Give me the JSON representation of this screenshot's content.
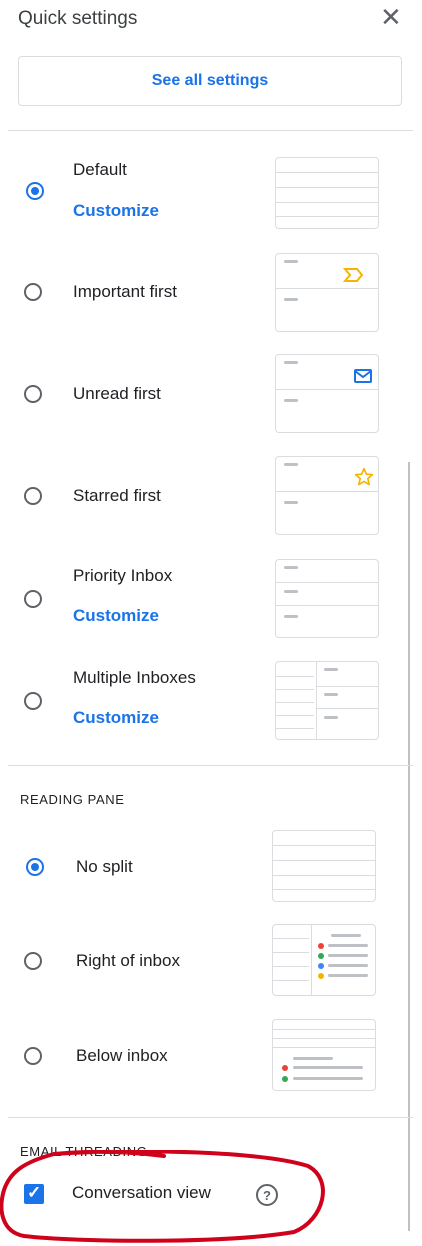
{
  "header": {
    "title": "Quick settings",
    "close_glyph": "✕"
  },
  "see_all_label": "See all settings",
  "inbox_types": [
    {
      "label": "Default",
      "customize": "Customize",
      "selected": true
    },
    {
      "label": "Important first",
      "customize": "",
      "selected": false
    },
    {
      "label": "Unread first",
      "customize": "",
      "selected": false
    },
    {
      "label": "Starred first",
      "customize": "",
      "selected": false
    },
    {
      "label": "Priority Inbox",
      "customize": "Customize",
      "selected": false
    },
    {
      "label": "Multiple Inboxes",
      "customize": "Customize",
      "selected": false
    }
  ],
  "reading_pane": {
    "heading": "READING PANE",
    "options": [
      {
        "label": "No split",
        "selected": true
      },
      {
        "label": "Right of inbox",
        "selected": false
      },
      {
        "label": "Below inbox",
        "selected": false
      }
    ]
  },
  "email_threading": {
    "heading": "EMAIL THREADING",
    "conversation_view_label": "Conversation view",
    "conversation_view_checked": true,
    "help_glyph": "?"
  },
  "colors": {
    "accent": "#1a73e8",
    "annotation": "#d0021b",
    "importance": "#f4b400"
  }
}
